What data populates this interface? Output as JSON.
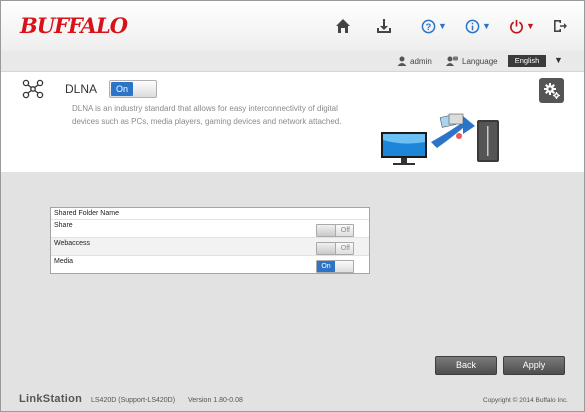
{
  "header": {
    "logo": "BUFFALO",
    "icons": [
      "home-icon",
      "download-icon",
      "help-icon",
      "info-icon",
      "power-icon",
      "logout-icon"
    ],
    "help_caret": "▼",
    "info_caret": "▼",
    "power_caret": "▼"
  },
  "subbar": {
    "user": "admin",
    "language_label": "Language",
    "language_value": "English",
    "language_caret": "▼"
  },
  "dlna": {
    "title": "DLNA",
    "toggle": "On",
    "description": "DLNA is an industry standard that allows for easy interconnectivity of digital devices such as PCs, media players, gaming devices and network attached."
  },
  "table": {
    "header": "Shared Folder Name",
    "rows": [
      {
        "name": "Share",
        "state": "Off"
      },
      {
        "name": "Webaccess",
        "state": "Off"
      },
      {
        "name": "Media",
        "state": "On"
      }
    ]
  },
  "buttons": {
    "back": "Back",
    "apply": "Apply"
  },
  "footer": {
    "product": "LinkStation",
    "model": "LS420D (Support-LS420D)",
    "version": "Version 1.80-0.08",
    "copyright": "Copyright © 2014 Buffalo Inc."
  },
  "colors": {
    "brand_red": "#d9121a",
    "accent_blue": "#2b74c8",
    "power_red": "#c2141c"
  }
}
